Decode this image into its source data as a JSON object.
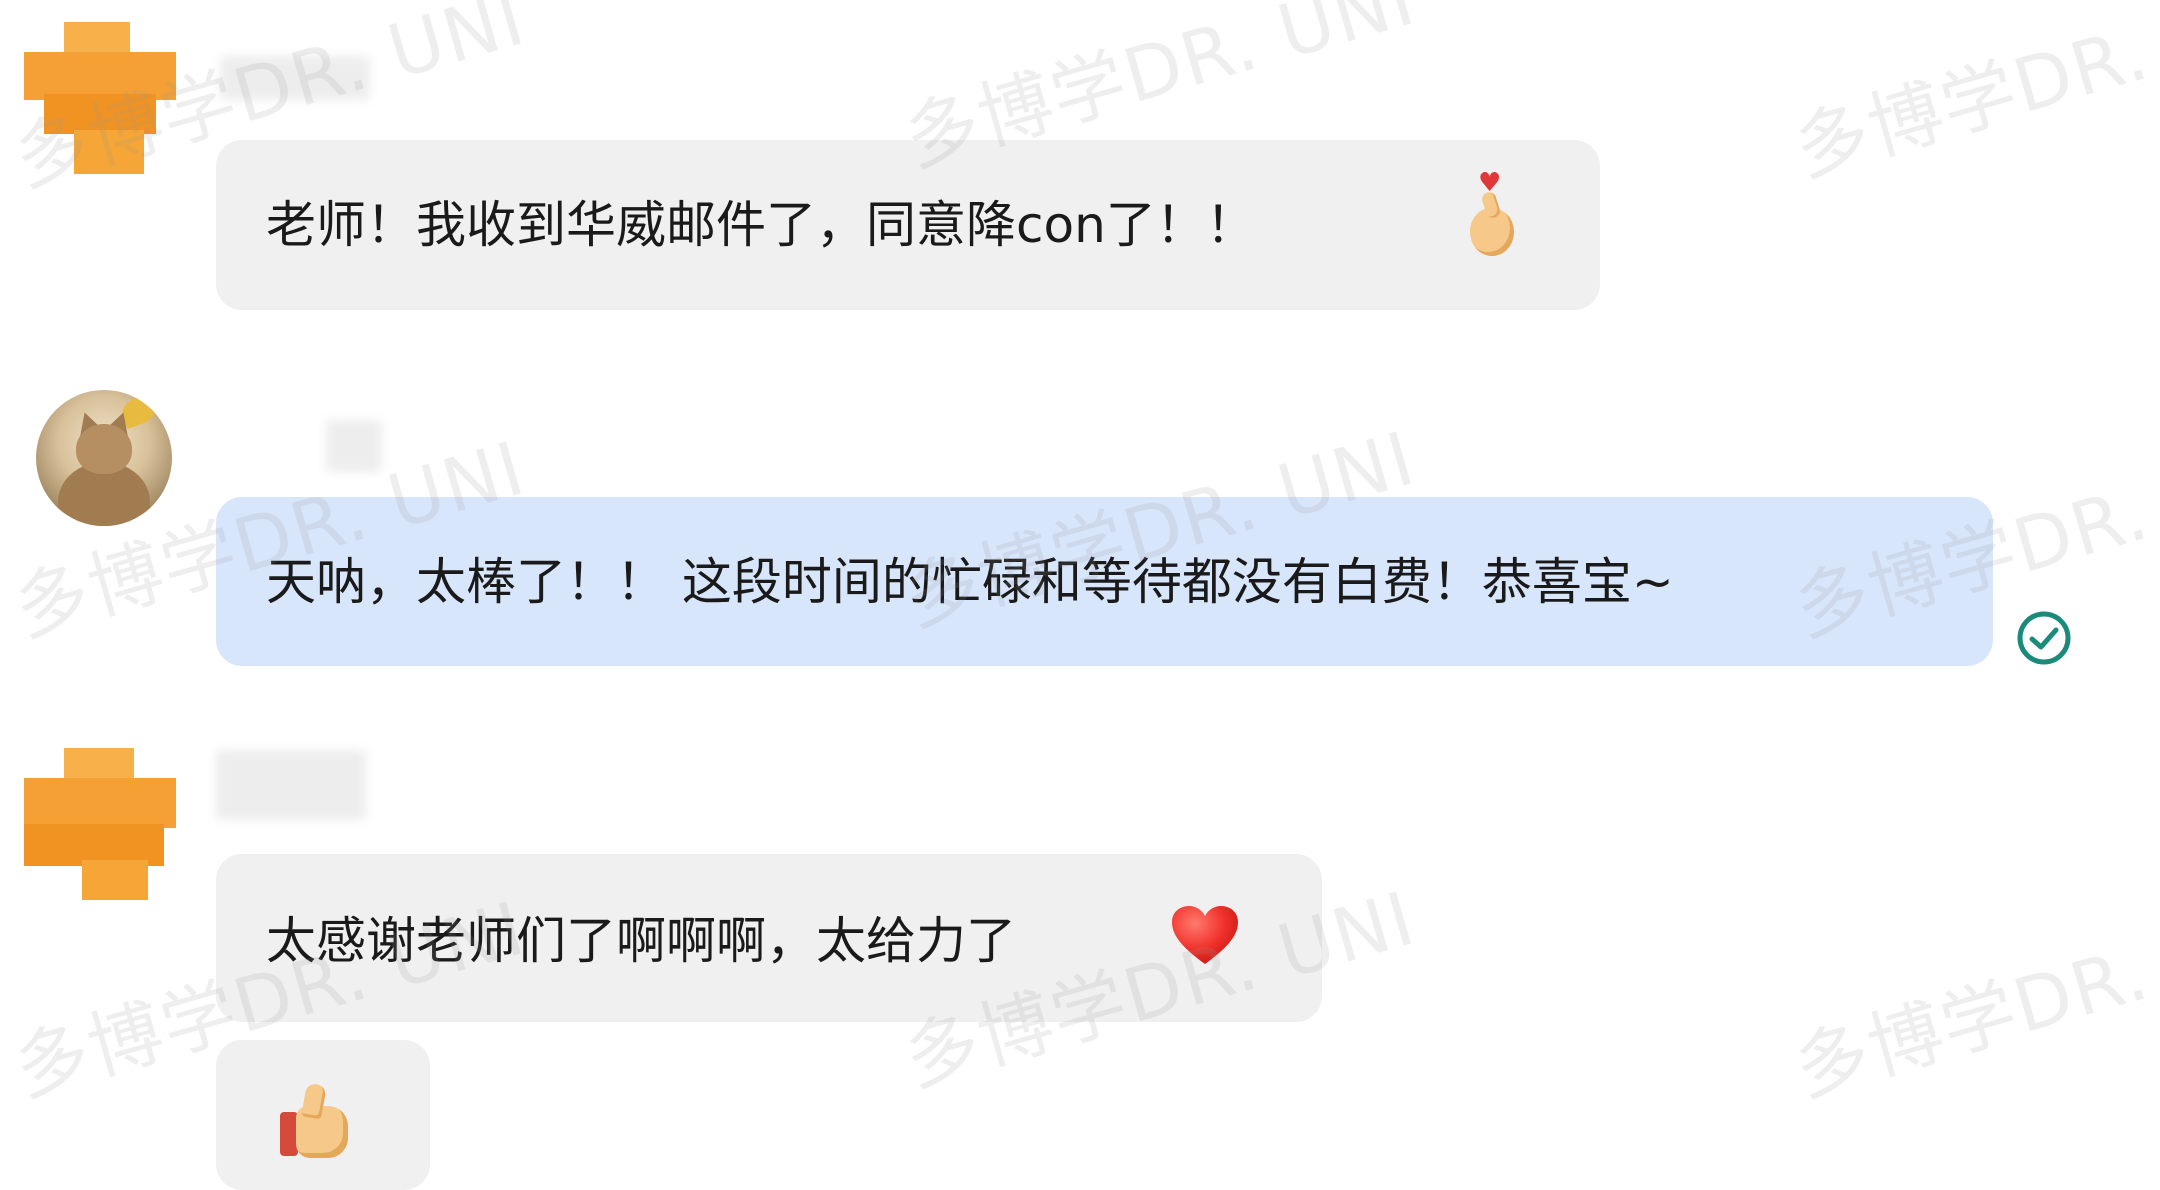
{
  "messages": [
    {
      "text": "老师！我收到华威邮件了，同意降con了！！",
      "emoji": "finger-heart-icon"
    },
    {
      "text": "天呐，太棒了！！ 这段时间的忙碌和等待都没有白费！恭喜宝~",
      "status_icon": "read-check-icon"
    },
    {
      "text": "太感谢老师们了啊啊啊，太给力了",
      "emoji": "red-heart-icon"
    },
    {
      "emoji": "thumbs-up-icon"
    }
  ],
  "watermark": {
    "text": "多博学DR. UNI"
  },
  "colors": {
    "incoming_bubble": "#f0f0f0",
    "outgoing_bubble": "#d8e6fb",
    "read_check": "#1a8a7a",
    "pixel_avatar_orange": "#f5a530"
  }
}
